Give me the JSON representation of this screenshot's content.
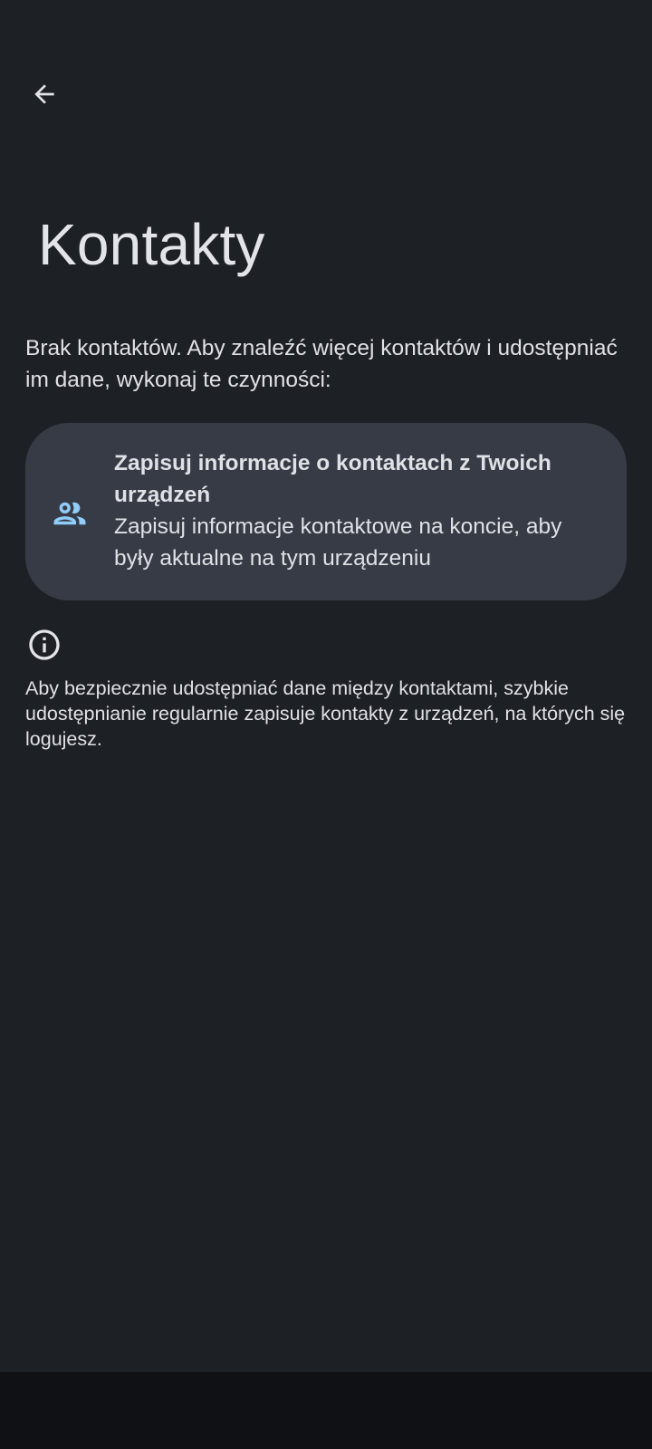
{
  "header": {
    "back_icon": "arrow-back-icon",
    "title": "Kontakty"
  },
  "intro_text": "Brak kontaktów. Aby znaleźć więcej kontaktów i udostępniać im dane, wykonaj te czynności:",
  "save_card": {
    "icon": "people-icon",
    "title": "Zapisuj informacje o kontaktach z Twoich urządzeń",
    "description": "Zapisuj informacje kontaktowe na koncie, aby były aktualne na tym urządzeniu"
  },
  "info": {
    "icon": "info-icon",
    "text": "Aby bezpiecznie udostępniać dane między kontaktami, szybkie udostępnianie regularnie zapisuje kontakty z urządzeń, na których się logujesz."
  },
  "colors": {
    "background": "#1d2024",
    "card_background": "#373b45",
    "accent_icon": "#8fcdfa",
    "text": "#e2e4ea",
    "nav_bar": "#0f1114"
  }
}
